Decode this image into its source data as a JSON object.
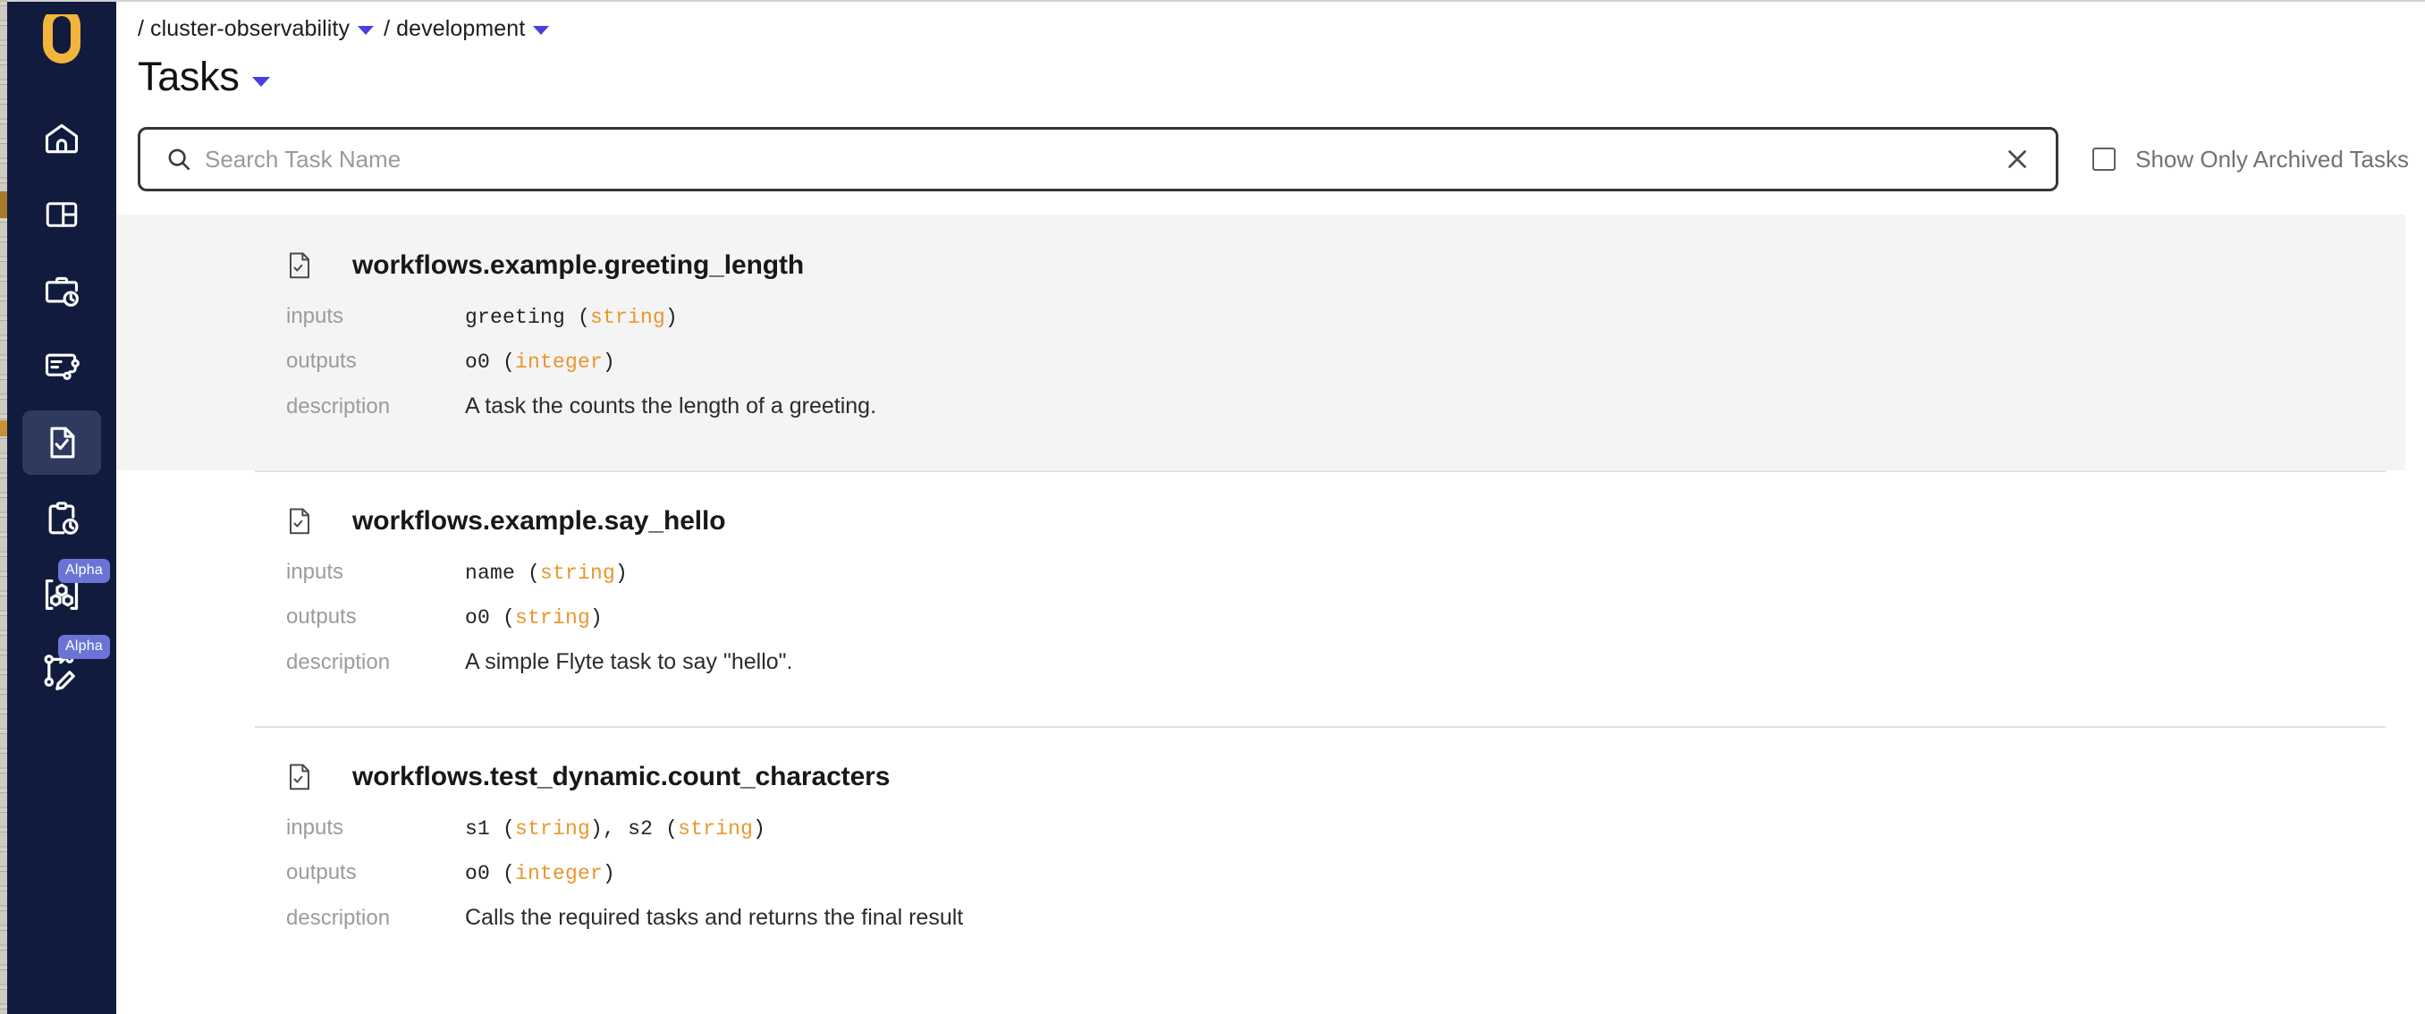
{
  "colors": {
    "sidebar_bg": "#111b3d",
    "sidebar_active": "#2e3a5e",
    "logo": "#f2b53c",
    "accent_caret": "#4b3ee0",
    "badge": "#6b74d6",
    "type_orange": "#e8972d",
    "card_hover": "#f4f4f4"
  },
  "sidebar": {
    "logo_name": "union-logo",
    "items": [
      {
        "name": "home",
        "icon": "home-icon",
        "badge": "",
        "active": false
      },
      {
        "name": "dashboard",
        "icon": "dashboard-panels-icon",
        "badge": "",
        "active": false
      },
      {
        "name": "workflows",
        "icon": "briefcase-clock-icon",
        "badge": "",
        "active": false
      },
      {
        "name": "executions",
        "icon": "card-branch-icon",
        "badge": "",
        "active": false
      },
      {
        "name": "tasks",
        "icon": "document-check-icon",
        "badge": "",
        "active": true
      },
      {
        "name": "launch-plans",
        "icon": "clipboard-clock-icon",
        "badge": "",
        "active": false
      },
      {
        "name": "artifacts",
        "icon": "cubes-bracket-icon",
        "badge": "Alpha",
        "active": false
      },
      {
        "name": "flows-editor",
        "icon": "graph-pencil-icon",
        "badge": "Alpha",
        "active": false
      }
    ]
  },
  "breadcrumb": {
    "project": "cluster-observability",
    "domain": "development",
    "slash": "/"
  },
  "header": {
    "title": "Tasks"
  },
  "search": {
    "placeholder": "Search Task Name",
    "value": "",
    "clear_label": "Clear search"
  },
  "filters": {
    "archived_label": "Show Only Archived Tasks",
    "archived_checked": false
  },
  "labels": {
    "inputs": "inputs",
    "outputs": "outputs",
    "description": "description"
  },
  "tasks": [
    {
      "name": "workflows.example.greeting_length",
      "hovered": true,
      "inputs": [
        {
          "arg": "greeting",
          "type": "string"
        }
      ],
      "outputs": [
        {
          "arg": "o0",
          "type": "integer"
        }
      ],
      "description": "A task the counts the length of a greeting."
    },
    {
      "name": "workflows.example.say_hello",
      "hovered": false,
      "inputs": [
        {
          "arg": "name",
          "type": "string"
        }
      ],
      "outputs": [
        {
          "arg": "o0",
          "type": "string"
        }
      ],
      "description": "A simple Flyte task to say \"hello\"."
    },
    {
      "name": "workflows.test_dynamic.count_characters",
      "hovered": false,
      "inputs": [
        {
          "arg": "s1",
          "type": "string"
        },
        {
          "arg": "s2",
          "type": "string"
        }
      ],
      "outputs": [
        {
          "arg": "o0",
          "type": "integer"
        }
      ],
      "description": "Calls the required tasks and returns the final result"
    }
  ]
}
